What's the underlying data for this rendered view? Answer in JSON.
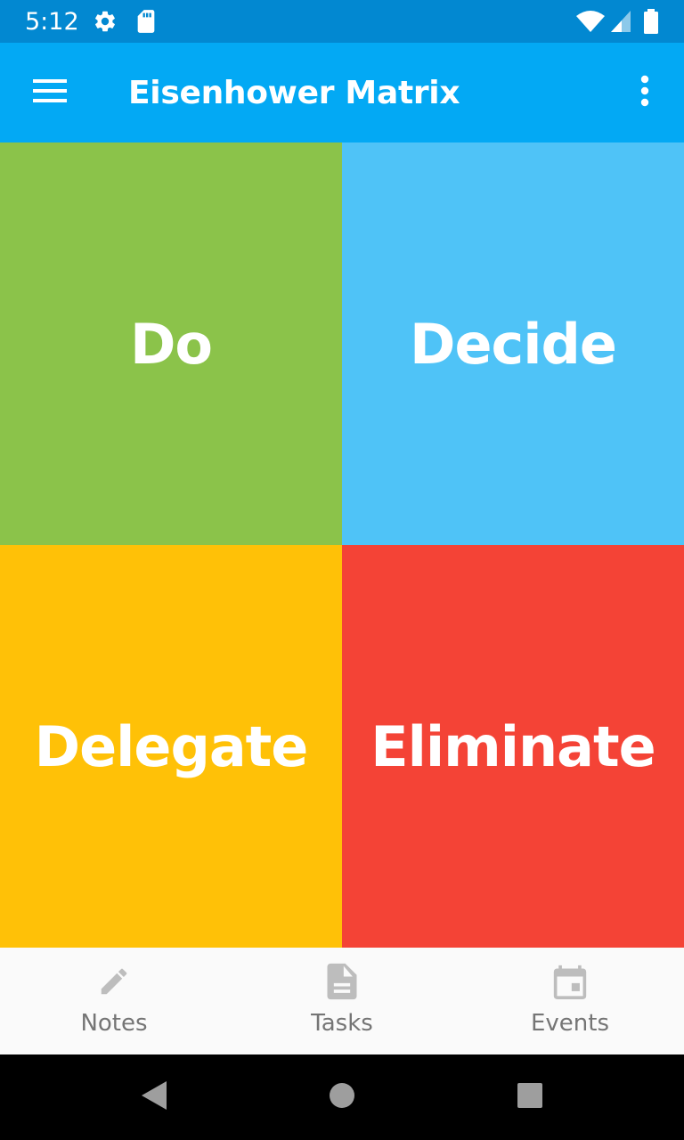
{
  "status_bar": {
    "time": "5:12",
    "icons": [
      "settings-icon",
      "sd-card-icon",
      "wifi-icon",
      "signal-icon",
      "battery-icon"
    ]
  },
  "app_bar": {
    "title": "Eisenhower Matrix",
    "menu_icon": "menu-icon",
    "overflow_icon": "more-vert-icon"
  },
  "matrix": {
    "quadrants": [
      {
        "label": "Do",
        "color": "#8BC34A"
      },
      {
        "label": "Decide",
        "color": "#4FC3F7"
      },
      {
        "label": "Delegate",
        "color": "#FFC107"
      },
      {
        "label": "Eliminate",
        "color": "#F44336"
      }
    ]
  },
  "bottom_nav": {
    "items": [
      {
        "label": "Notes",
        "icon": "pencil-icon"
      },
      {
        "label": "Tasks",
        "icon": "document-icon"
      },
      {
        "label": "Events",
        "icon": "calendar-icon"
      }
    ]
  },
  "system_nav": {
    "icons": [
      "back-icon",
      "home-icon",
      "recents-icon"
    ]
  }
}
